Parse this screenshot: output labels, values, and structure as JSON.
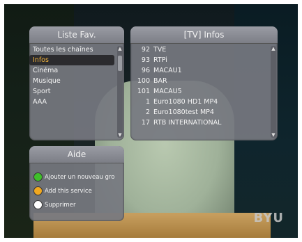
{
  "fav_panel": {
    "title": "Liste Fav.",
    "items": [
      {
        "label": "Toutes les chaînes",
        "selected": false
      },
      {
        "label": "Infos",
        "selected": true
      },
      {
        "label": "Cinéma",
        "selected": false
      },
      {
        "label": "Musique",
        "selected": false
      },
      {
        "label": "Sport",
        "selected": false
      },
      {
        "label": "AAA",
        "selected": false
      }
    ]
  },
  "channel_panel": {
    "title": "[TV] Infos",
    "channels": [
      {
        "num": "92",
        "name": "TVE"
      },
      {
        "num": "93",
        "name": "RTPi"
      },
      {
        "num": "96",
        "name": "MACAU1"
      },
      {
        "num": "100",
        "name": "BAR"
      },
      {
        "num": "101",
        "name": "MACAU5"
      },
      {
        "num": "1",
        "name": "Euro1080 HD1 MP4"
      },
      {
        "num": "2",
        "name": "Euro1080test MP4"
      },
      {
        "num": "17",
        "name": "RTB INTERNATIONAL"
      }
    ]
  },
  "help_panel": {
    "title": "Aide",
    "actions": [
      {
        "color": "#3fbf2a",
        "label": "Ajouter un nouveau gro"
      },
      {
        "color": "#f0a820",
        "label": "Add this service"
      },
      {
        "color": "#ffffff",
        "label": "Supprimer"
      }
    ]
  },
  "watermark": "BYU"
}
